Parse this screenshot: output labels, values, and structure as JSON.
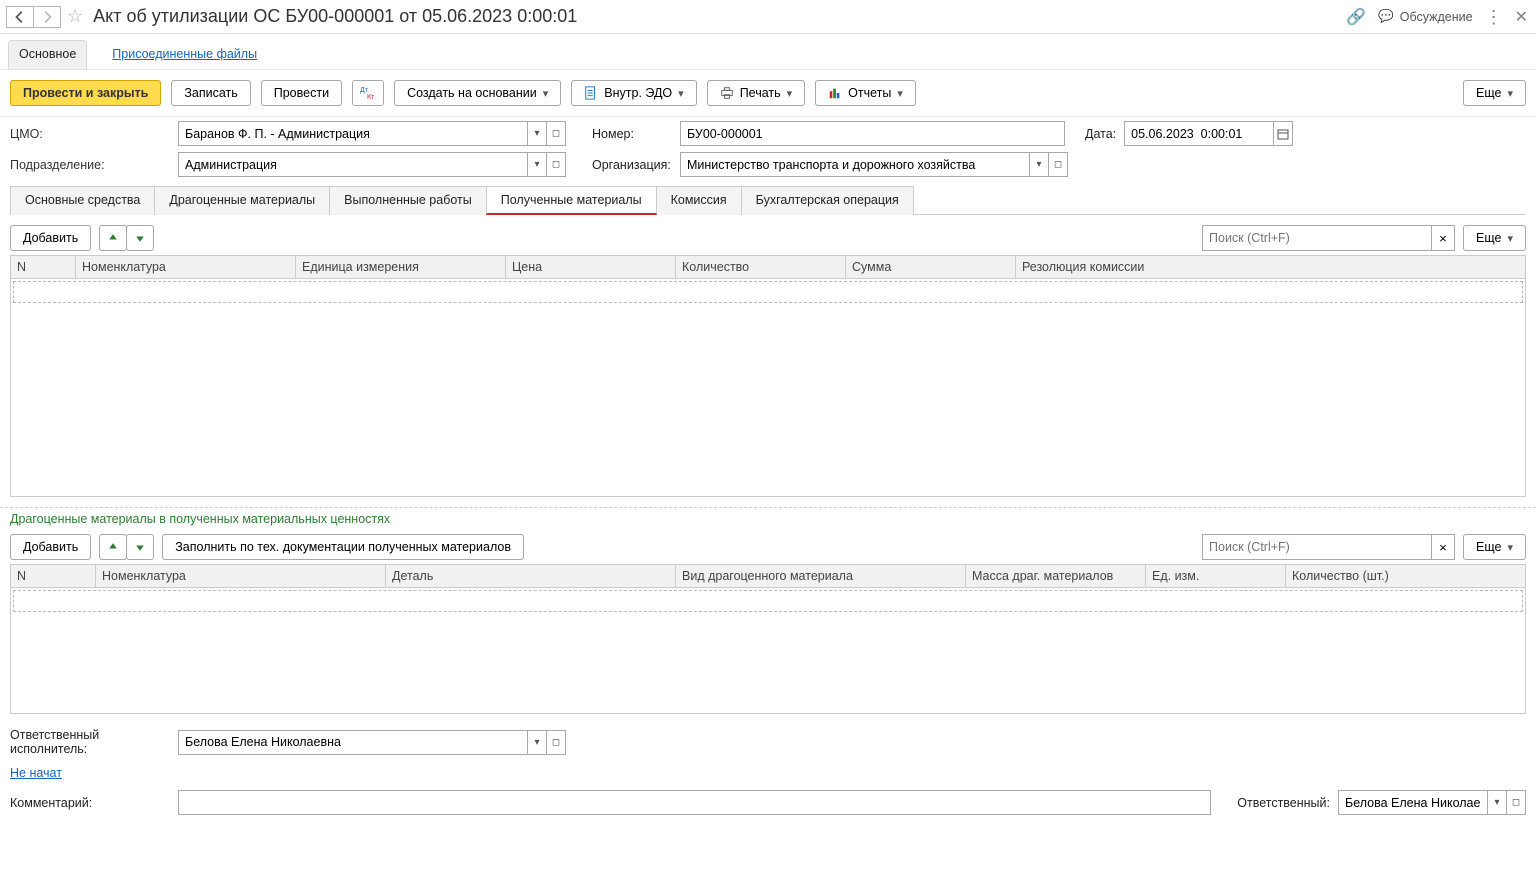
{
  "header": {
    "title": "Акт об утилизации ОС БУ00-000001 от 05.06.2023 0:00:01",
    "discussion_label": "Обсуждение"
  },
  "subnav": {
    "main": "Основное",
    "attached_files": "Присоединенные файлы"
  },
  "toolbar": {
    "post_and_close": "Провести и закрыть",
    "save": "Записать",
    "post": "Провести",
    "create_based_on": "Создать на основании",
    "internal_edo": "Внутр. ЭДО",
    "print": "Печать",
    "reports": "Отчеты",
    "more": "Еще"
  },
  "form": {
    "cmo_label": "ЦМО:",
    "cmo_value": "Баранов Ф. П. - Администрация",
    "dept_label": "Подразделение:",
    "dept_value": "Администрация",
    "number_label": "Номер:",
    "number_value": "БУ00-000001",
    "date_label": "Дата:",
    "date_value": "05.06.2023  0:00:01",
    "org_label": "Организация:",
    "org_value": "Министерство транспорта и дорожного хозяйства"
  },
  "tabs": {
    "t1": "Основные средства",
    "t2": "Драгоценные материалы",
    "t3": "Выполненные работы",
    "t4": "Полученные материалы",
    "t5": "Комиссия",
    "t6": "Бухгалтерская операция"
  },
  "table1": {
    "add": "Добавить",
    "search_placeholder": "Поиск (Ctrl+F)",
    "more": "Еще",
    "cols": {
      "n": "N",
      "nomen": "Номенклатура",
      "unit": "Единица измерения",
      "price": "Цена",
      "qty": "Количество",
      "sum": "Сумма",
      "resolution": "Резолюция комиссии"
    }
  },
  "green_heading": "Драгоценные материалы в полученных материальных ценностях",
  "table2": {
    "add": "Добавить",
    "fill_tech": "Заполнить по тех. документации полученных материалов",
    "search_placeholder": "Поиск (Ctrl+F)",
    "more": "Еще",
    "cols": {
      "n": "N",
      "nomen": "Номенклатура",
      "detail": "Деталь",
      "kind": "Вид драгоценного материала",
      "mass": "Масса драг. материалов",
      "unit": "Ед. изм.",
      "qty": "Количество (шт.)"
    }
  },
  "footer": {
    "resp_exec_label": "Ответственный исполнитель:",
    "resp_exec_value": "Белова Елена Николаевна",
    "not_started": "Не начат",
    "comment_label": "Комментарий:",
    "comment_value": "",
    "resp_label": "Ответственный:",
    "resp_value": "Белова Елена Николаевн"
  }
}
